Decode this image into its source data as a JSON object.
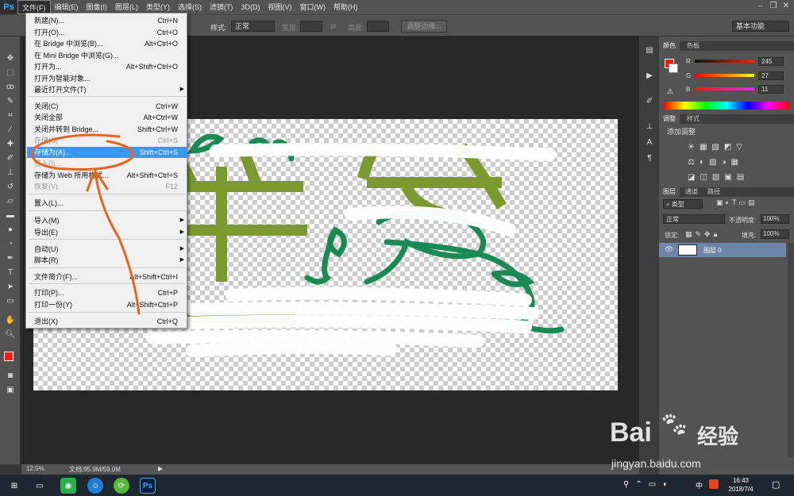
{
  "app": {
    "logo": "Ps"
  },
  "menubar": {
    "items": [
      "文件(F)",
      "编辑(E)",
      "图像(I)",
      "图层(L)",
      "类型(Y)",
      "选择(S)",
      "滤镜(T)",
      "3D(D)",
      "视图(V)",
      "窗口(W)",
      "帮助(H)"
    ]
  },
  "options": {
    "style_label": "样式:",
    "style_value": "正常",
    "width_label": "宽度:",
    "height_label": "高度:",
    "refine_button": "调整边缘...",
    "workspace": "基本功能"
  },
  "file_menu": [
    {
      "label": "新建(N)...",
      "shortcut": "Ctrl+N"
    },
    {
      "label": "打开(O)...",
      "shortcut": "Ctrl+O"
    },
    {
      "label": "在 Bridge 中浏览(B)...",
      "shortcut": "Alt+Ctrl+O"
    },
    {
      "label": "在 Mini Bridge 中浏览(G)...",
      "shortcut": ""
    },
    {
      "label": "打开为...",
      "shortcut": "Alt+Shift+Ctrl+O"
    },
    {
      "label": "打开为智能对象...",
      "shortcut": ""
    },
    {
      "label": "最近打开文件(T)",
      "shortcut": ""
    },
    {
      "label": "关闭(C)",
      "shortcut": "Ctrl+W"
    },
    {
      "label": "关闭全部",
      "shortcut": "Alt+Ctrl+W"
    },
    {
      "label": "关闭并转到 Bridge...",
      "shortcut": "Shift+Ctrl+W"
    },
    {
      "label": "存储(S)",
      "shortcut": "Ctrl+S"
    },
    {
      "label": "存储为(A)...",
      "shortcut": "Shift+Ctrl+S"
    },
    {
      "label": "签入(I)...",
      "shortcut": ""
    },
    {
      "label": "存储为 Web 所用格式...",
      "shortcut": "Alt+Shift+Ctrl+S"
    },
    {
      "label": "恢复(V)",
      "shortcut": "F12"
    },
    {
      "label": "置入(L)...",
      "shortcut": ""
    },
    {
      "label": "导入(M)",
      "shortcut": ""
    },
    {
      "label": "导出(E)",
      "shortcut": ""
    },
    {
      "label": "自动(U)",
      "shortcut": ""
    },
    {
      "label": "脚本(R)",
      "shortcut": ""
    },
    {
      "label": "文件简介(F)...",
      "shortcut": "Alt+Shift+Ctrl+I"
    },
    {
      "label": "打印(P)...",
      "shortcut": "Ctrl+P"
    },
    {
      "label": "打印一份(Y)",
      "shortcut": "Alt+Shift+Ctrl+P"
    },
    {
      "label": "退出(X)",
      "shortcut": "Ctrl+Q"
    }
  ],
  "status": {
    "zoom": "12.5%",
    "doc": "文档:95.9M/59.0M"
  },
  "color_panel": {
    "tabs": [
      "颜色",
      "色板"
    ],
    "r_label": "R",
    "g_label": "G",
    "b_label": "B",
    "r": "245",
    "g": "27",
    "b": "11",
    "foreground": "#f51b0b"
  },
  "adjust_panel": {
    "tabs": [
      "调整",
      "样式"
    ],
    "title": "添加调整"
  },
  "layers_panel": {
    "tabs": [
      "图层",
      "通道",
      "路径"
    ],
    "filter": "类型",
    "blend": "正常",
    "opacity_label": "不透明度:",
    "opacity": "100%",
    "lock_label": "锁定:",
    "fill_label": "填充:",
    "fill": "100%",
    "layer_name": "图层 0"
  },
  "taskbar": {
    "time": "16:43",
    "date": "2018/7/4",
    "ime": "中"
  },
  "watermark": {
    "brand": "Bai",
    "brand2": "经验",
    "url": "jingyan.baidu.com"
  }
}
